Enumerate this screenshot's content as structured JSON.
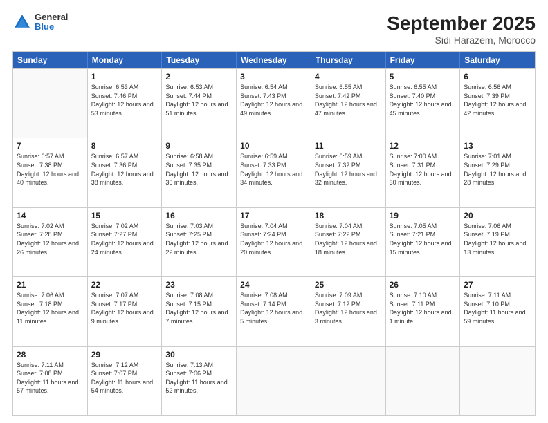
{
  "header": {
    "logo": {
      "general": "General",
      "blue": "Blue"
    },
    "title": "September 2025",
    "subtitle": "Sidi Harazem, Morocco"
  },
  "days_of_week": [
    "Sunday",
    "Monday",
    "Tuesday",
    "Wednesday",
    "Thursday",
    "Friday",
    "Saturday"
  ],
  "weeks": [
    [
      {
        "day": "",
        "empty": true
      },
      {
        "day": "1",
        "sunrise": "6:53 AM",
        "sunset": "7:46 PM",
        "daylight": "12 hours and 53 minutes."
      },
      {
        "day": "2",
        "sunrise": "6:53 AM",
        "sunset": "7:44 PM",
        "daylight": "12 hours and 51 minutes."
      },
      {
        "day": "3",
        "sunrise": "6:54 AM",
        "sunset": "7:43 PM",
        "daylight": "12 hours and 49 minutes."
      },
      {
        "day": "4",
        "sunrise": "6:55 AM",
        "sunset": "7:42 PM",
        "daylight": "12 hours and 47 minutes."
      },
      {
        "day": "5",
        "sunrise": "6:55 AM",
        "sunset": "7:40 PM",
        "daylight": "12 hours and 45 minutes."
      },
      {
        "day": "6",
        "sunrise": "6:56 AM",
        "sunset": "7:39 PM",
        "daylight": "12 hours and 42 minutes."
      }
    ],
    [
      {
        "day": "7",
        "sunrise": "6:57 AM",
        "sunset": "7:38 PM",
        "daylight": "12 hours and 40 minutes."
      },
      {
        "day": "8",
        "sunrise": "6:57 AM",
        "sunset": "7:36 PM",
        "daylight": "12 hours and 38 minutes."
      },
      {
        "day": "9",
        "sunrise": "6:58 AM",
        "sunset": "7:35 PM",
        "daylight": "12 hours and 36 minutes."
      },
      {
        "day": "10",
        "sunrise": "6:59 AM",
        "sunset": "7:33 PM",
        "daylight": "12 hours and 34 minutes."
      },
      {
        "day": "11",
        "sunrise": "6:59 AM",
        "sunset": "7:32 PM",
        "daylight": "12 hours and 32 minutes."
      },
      {
        "day": "12",
        "sunrise": "7:00 AM",
        "sunset": "7:31 PM",
        "daylight": "12 hours and 30 minutes."
      },
      {
        "day": "13",
        "sunrise": "7:01 AM",
        "sunset": "7:29 PM",
        "daylight": "12 hours and 28 minutes."
      }
    ],
    [
      {
        "day": "14",
        "sunrise": "7:02 AM",
        "sunset": "7:28 PM",
        "daylight": "12 hours and 26 minutes."
      },
      {
        "day": "15",
        "sunrise": "7:02 AM",
        "sunset": "7:27 PM",
        "daylight": "12 hours and 24 minutes."
      },
      {
        "day": "16",
        "sunrise": "7:03 AM",
        "sunset": "7:25 PM",
        "daylight": "12 hours and 22 minutes."
      },
      {
        "day": "17",
        "sunrise": "7:04 AM",
        "sunset": "7:24 PM",
        "daylight": "12 hours and 20 minutes."
      },
      {
        "day": "18",
        "sunrise": "7:04 AM",
        "sunset": "7:22 PM",
        "daylight": "12 hours and 18 minutes."
      },
      {
        "day": "19",
        "sunrise": "7:05 AM",
        "sunset": "7:21 PM",
        "daylight": "12 hours and 15 minutes."
      },
      {
        "day": "20",
        "sunrise": "7:06 AM",
        "sunset": "7:19 PM",
        "daylight": "12 hours and 13 minutes."
      }
    ],
    [
      {
        "day": "21",
        "sunrise": "7:06 AM",
        "sunset": "7:18 PM",
        "daylight": "12 hours and 11 minutes."
      },
      {
        "day": "22",
        "sunrise": "7:07 AM",
        "sunset": "7:17 PM",
        "daylight": "12 hours and 9 minutes."
      },
      {
        "day": "23",
        "sunrise": "7:08 AM",
        "sunset": "7:15 PM",
        "daylight": "12 hours and 7 minutes."
      },
      {
        "day": "24",
        "sunrise": "7:08 AM",
        "sunset": "7:14 PM",
        "daylight": "12 hours and 5 minutes."
      },
      {
        "day": "25",
        "sunrise": "7:09 AM",
        "sunset": "7:12 PM",
        "daylight": "12 hours and 3 minutes."
      },
      {
        "day": "26",
        "sunrise": "7:10 AM",
        "sunset": "7:11 PM",
        "daylight": "12 hours and 1 minute."
      },
      {
        "day": "27",
        "sunrise": "7:11 AM",
        "sunset": "7:10 PM",
        "daylight": "11 hours and 59 minutes."
      }
    ],
    [
      {
        "day": "28",
        "sunrise": "7:11 AM",
        "sunset": "7:08 PM",
        "daylight": "11 hours and 57 minutes."
      },
      {
        "day": "29",
        "sunrise": "7:12 AM",
        "sunset": "7:07 PM",
        "daylight": "11 hours and 54 minutes."
      },
      {
        "day": "30",
        "sunrise": "7:13 AM",
        "sunset": "7:06 PM",
        "daylight": "11 hours and 52 minutes."
      },
      {
        "day": "",
        "empty": true
      },
      {
        "day": "",
        "empty": true
      },
      {
        "day": "",
        "empty": true
      },
      {
        "day": "",
        "empty": true
      }
    ]
  ]
}
